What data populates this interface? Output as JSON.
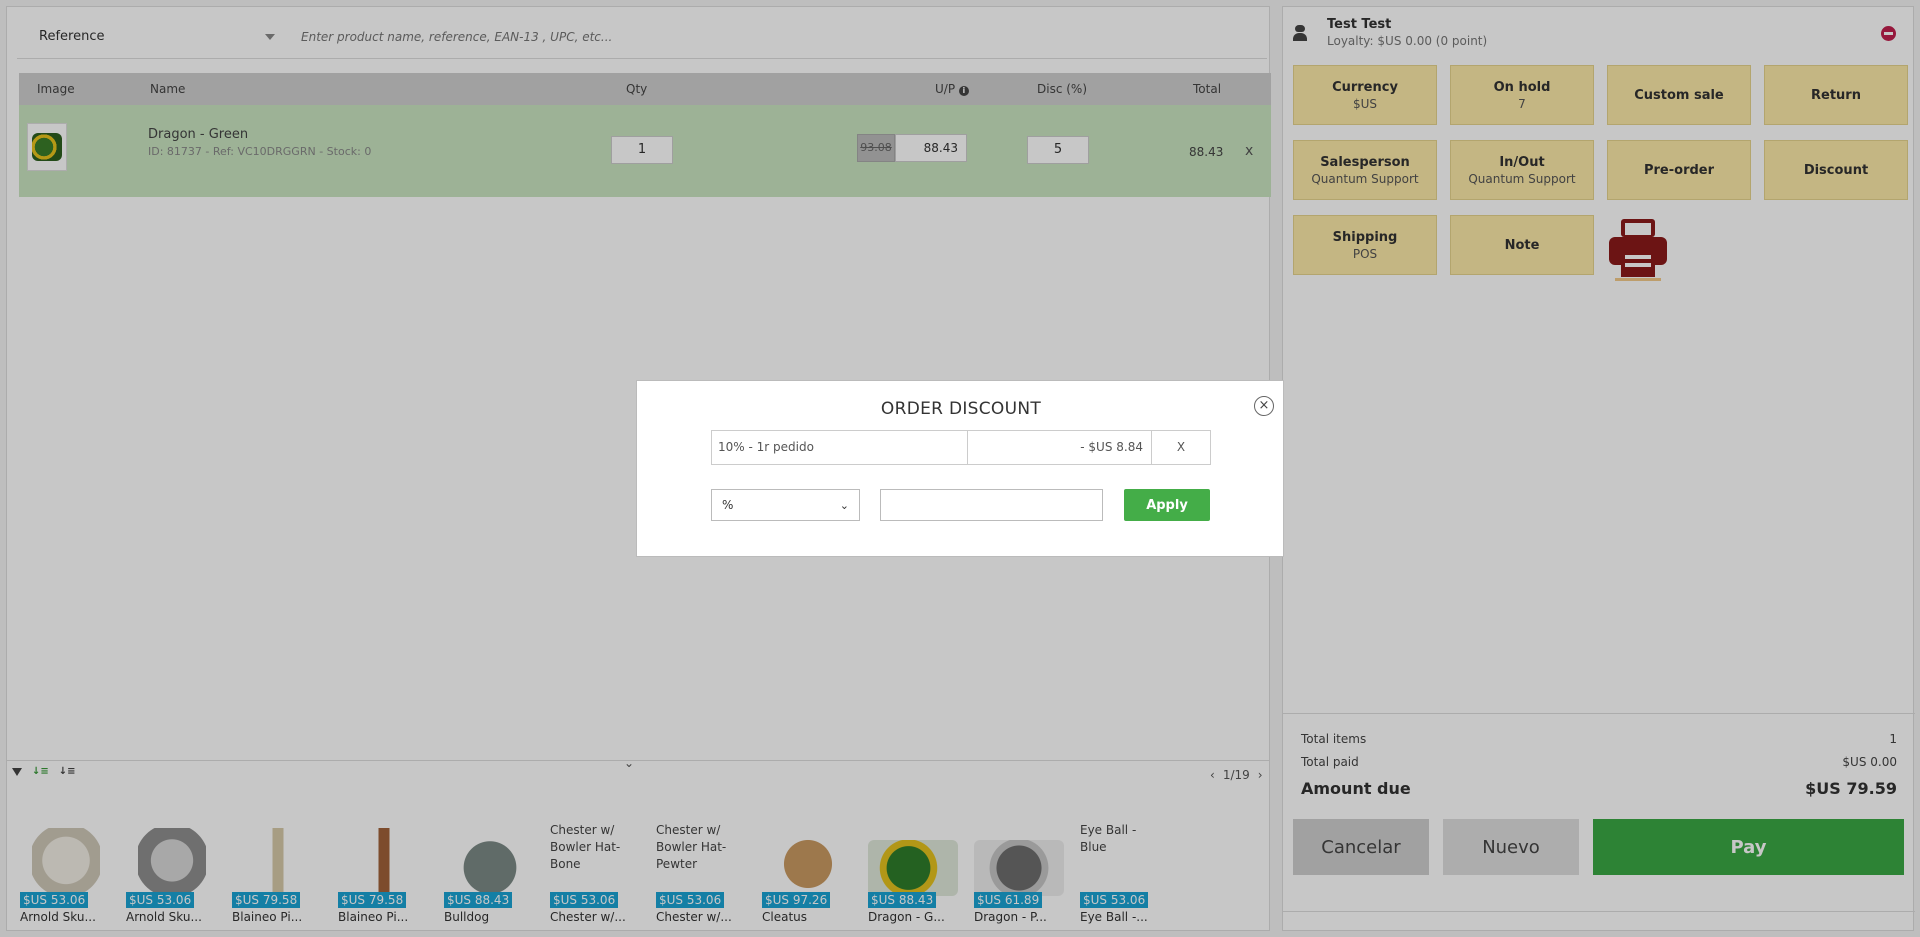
{
  "search": {
    "type_label": "Reference",
    "placeholder": "Enter product name, reference, EAN-13 , UPC, etc..."
  },
  "cart": {
    "headers": {
      "image": "Image",
      "name": "Name",
      "qty": "Qty",
      "unit_price": "U/P",
      "discount": "Disc (%)",
      "total": "Total"
    },
    "rows": [
      {
        "name": "Dragon - Green",
        "meta": "ID: 81737 - Ref: VC10DRGGRN - Stock: 0",
        "qty": "1",
        "old_price": "93.08",
        "unit_price": "88.43",
        "discount": "5",
        "total": "88.43",
        "remove": "x"
      }
    ]
  },
  "strip": {
    "page": "1/19",
    "prev": "‹",
    "next": "›",
    "products": [
      {
        "price": "$US 53.06",
        "name": "Arnold Sku...",
        "color": "#d9d4c8"
      },
      {
        "price": "$US 53.06",
        "name": "Arnold Sku...",
        "color": "#bdbdbd"
      },
      {
        "price": "$US 79.58",
        "name": "Blaineo Pi...",
        "color": "#c9b79a"
      },
      {
        "price": "$US 79.58",
        "name": "Blaineo Pi...",
        "color": "#b07a4d"
      },
      {
        "price": "$US 88.43",
        "name": "Bulldog",
        "color": "#7d8a8a"
      },
      {
        "price": "$US 53.06",
        "name": "Chester w/...",
        "alt": "Chester w/ Bowler Hat-Bone"
      },
      {
        "price": "$US 53.06",
        "name": "Chester w/...",
        "alt": "Chester w/ Bowler Hat-Pewter"
      },
      {
        "price": "$US 97.26",
        "name": "Cleatus",
        "color": "#c9a06b"
      },
      {
        "price": "$US 88.43",
        "name": "Dragon - G...",
        "color": "#3a8a2e"
      },
      {
        "price": "$US 61.89",
        "name": "Dragon - P...",
        "color": "#8a8a8a"
      },
      {
        "price": "$US 53.06",
        "name": "Eye Ball -...",
        "alt": "Eye Ball - Blue"
      }
    ]
  },
  "customer": {
    "name": "Test Test",
    "loyalty": "Loyalty: $US 0.00 (0 point)"
  },
  "actions": [
    {
      "title": "Currency",
      "sub": "$US"
    },
    {
      "title": "On hold",
      "sub": "7"
    },
    {
      "title": "Custom sale",
      "sub": ""
    },
    {
      "title": "Return",
      "sub": ""
    },
    {
      "title": "Salesperson",
      "sub": "Quantum Support"
    },
    {
      "title": "In/Out",
      "sub": "Quantum Support"
    },
    {
      "title": "Pre-order",
      "sub": ""
    },
    {
      "title": "Discount",
      "sub": ""
    },
    {
      "title": "Shipping",
      "sub": "POS"
    },
    {
      "title": "Note",
      "sub": ""
    }
  ],
  "totals": {
    "items_label": "Total items",
    "items_value": "1",
    "paid_label": "Total paid",
    "paid_value": "$US 0.00",
    "due_label": "Amount due",
    "due_value": "$US 79.59"
  },
  "buttons": {
    "cancel": "Cancelar",
    "new": "Nuevo",
    "pay": "Pay"
  },
  "modal": {
    "title": "ORDER DISCOUNT",
    "close": "×",
    "discount_name": "10% - 1r pedido",
    "discount_amount": "- $US 8.84",
    "discount_remove": "X",
    "type_value": "%",
    "apply": "Apply"
  },
  "colors": {
    "tile": "#fce9a8",
    "pay": "#3aa845",
    "printer": "#8b1a1a",
    "price_badge": "#1aa3d4",
    "cart_row": "#c9e4c1"
  }
}
